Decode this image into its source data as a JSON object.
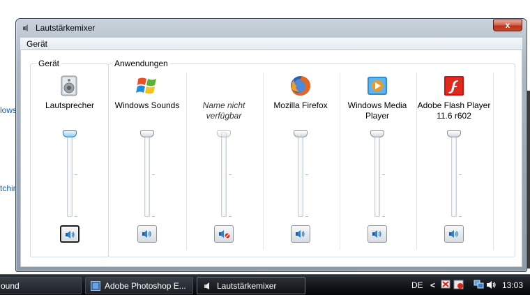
{
  "background": {
    "link1": "lows",
    "link2": "tchin"
  },
  "window": {
    "title": "Lautstärkemixer",
    "close_label": "x",
    "menu": {
      "geraet": "Gerät"
    }
  },
  "groups": {
    "device_label": "Gerät",
    "apps_label": "Anwendungen"
  },
  "channels": [
    {
      "label": "Lautsprecher",
      "icon": "speaker-icon",
      "volume": 1.0,
      "muted": false
    },
    {
      "label": "Windows Sounds",
      "icon": "windows-logo-icon",
      "volume": 1.0,
      "muted": false
    },
    {
      "label": "Name nicht verfügbar",
      "icon": "none",
      "volume": 1.0,
      "muted": true
    },
    {
      "label": "Mozilla Firefox",
      "icon": "firefox-icon",
      "volume": 1.0,
      "muted": false
    },
    {
      "label": "Windows Media Player",
      "icon": "media-player-icon",
      "volume": 1.0,
      "muted": false
    },
    {
      "label": "Adobe Flash Player 11.6 r602",
      "icon": "flash-player-icon",
      "volume": 1.0,
      "muted": false
    }
  ],
  "taskbar": {
    "item1": "ound",
    "item2": "Adobe Photoshop E...",
    "item3": "Lautstärkemixer",
    "lang": "DE",
    "clock": "13:03"
  },
  "colors": {
    "accent": "#3c7fb1",
    "close": "#c8462a",
    "taskbar": "#15181d"
  }
}
